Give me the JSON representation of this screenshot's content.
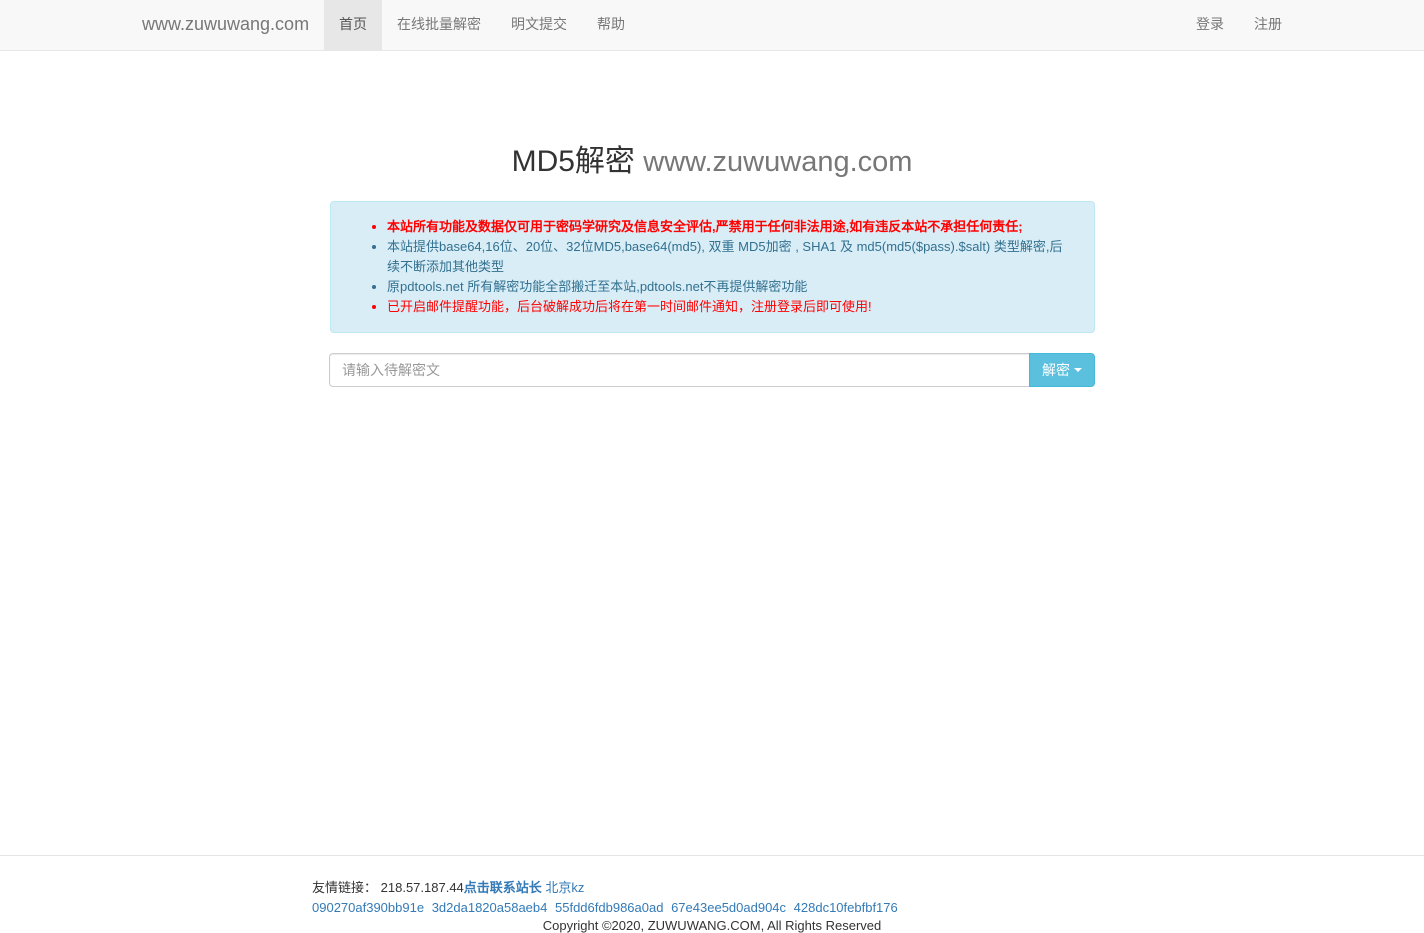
{
  "navbar": {
    "brand": "www.zuwuwang.com",
    "left_items": [
      {
        "label": "首页",
        "active": true
      },
      {
        "label": "在线批量解密",
        "active": false
      },
      {
        "label": "明文提交",
        "active": false
      },
      {
        "label": "帮助",
        "active": false
      }
    ],
    "right_items": [
      {
        "label": "登录"
      },
      {
        "label": "注册"
      }
    ]
  },
  "heading": {
    "main": "MD5解密",
    "sub": "www.zuwuwang.com"
  },
  "notice": {
    "items": [
      "本站所有功能及数据仅可用于密码学研究及信息安全评估,严禁用于任何非法用途,如有违反本站不承担任何责任;",
      "本站提供base64,16位、20位、32位MD5,base64(md5), 双重 MD5加密 , SHA1 及 md5(md5($pass).$salt) 类型解密,后续不断添加其他类型",
      "原pdtools.net 所有解密功能全部搬迁至本站,pdtools.net不再提供解密功能",
      "已开启邮件提醒功能，后台破解成功后将在第一时间邮件通知，注册登录后即可使用!"
    ]
  },
  "search": {
    "placeholder": "请输入待解密文",
    "value": "",
    "button_label": "解密"
  },
  "footer": {
    "links_label": "友情链接：",
    "ip_text": "218.57.187.44",
    "contact_text": "点击联系站长",
    "link_beijing": "北京kz",
    "hash_links": [
      "090270af390bb91e",
      "3d2da1820a58aeb4",
      "55fdd6fdb986a0ad",
      "67e43ee5d0ad904c",
      "428dc10febfbf176"
    ],
    "copyright": "Copyright ©2020, ZUWUWANG.COM, All Rights Reserved"
  },
  "colors": {
    "navbar_bg": "#f8f8f8",
    "alert_bg": "#d9edf7",
    "alert_text": "#31708f",
    "warning_red": "#ff0000",
    "button_info": "#5bc0de",
    "link_blue": "#337ab7"
  }
}
